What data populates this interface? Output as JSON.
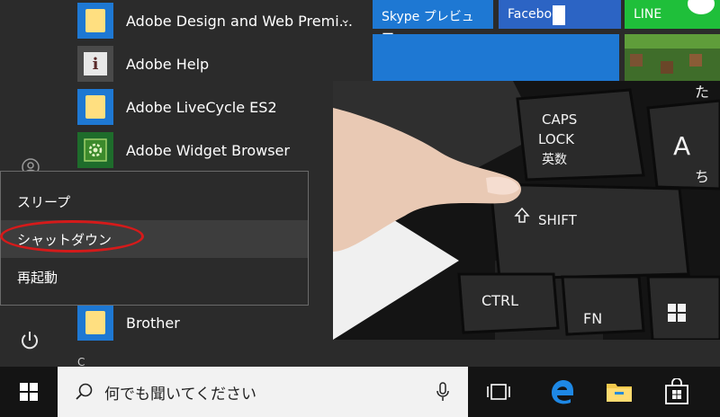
{
  "start_menu": {
    "apps": [
      {
        "label": "Adobe Design and Web Premi...",
        "icon": "folder-icon"
      },
      {
        "label": "Adobe Help",
        "icon": "info-icon"
      },
      {
        "label": "Adobe LiveCycle ES2",
        "icon": "folder-icon"
      },
      {
        "label": "Adobe Widget Browser",
        "icon": "gear-icon"
      },
      {
        "label": "Brother",
        "icon": "folder-icon"
      }
    ],
    "section_letter": "C"
  },
  "power_menu": {
    "items": [
      {
        "label": "スリープ"
      },
      {
        "label": "シャットダウン"
      },
      {
        "label": "再起動"
      }
    ],
    "highlight_color": "#d51a1a"
  },
  "tiles": {
    "skype": "Skype プレビュー",
    "facebook": "Faceboo",
    "line": "LINE"
  },
  "photo": {
    "keys": {
      "caps1": "CAPS",
      "caps2": "LOCK",
      "caps3": "英数",
      "q_kana": "た",
      "a": "A",
      "a_kana": "ち",
      "shift": "SHIFT",
      "ctrl": "CTRL",
      "fn": "FN"
    }
  },
  "taskbar": {
    "search_placeholder": "何でも聞いてください",
    "icons": [
      "windows-logo-icon",
      "microphone-icon",
      "task-view-icon",
      "edge-icon",
      "file-explorer-icon",
      "store-icon"
    ]
  },
  "colors": {
    "accent_blue": "#1e78d3",
    "taskbar_bg": "#141414",
    "menu_bg": "#2b2b2b",
    "line_green": "#1fbf3a"
  }
}
